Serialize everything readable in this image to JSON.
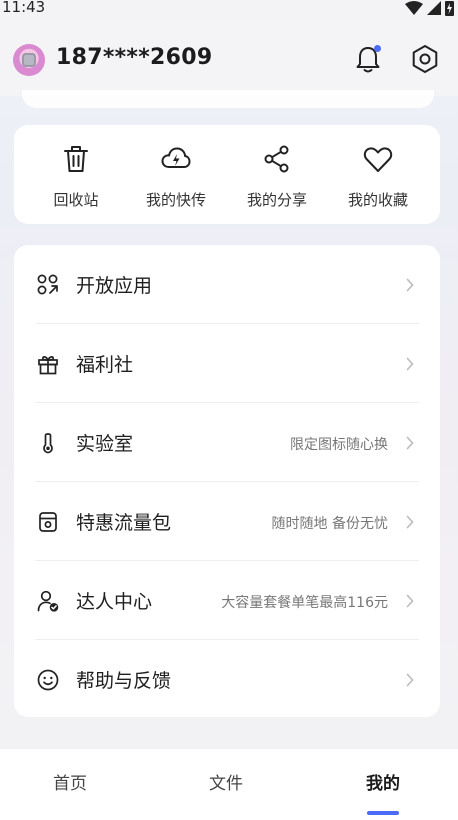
{
  "status": {
    "time": "11:43"
  },
  "header": {
    "username": "187****2609"
  },
  "quick_actions": [
    {
      "label": "回收站",
      "icon": "trash-icon"
    },
    {
      "label": "我的快传",
      "icon": "cloud-upload-icon"
    },
    {
      "label": "我的分享",
      "icon": "share-icon"
    },
    {
      "label": "我的收藏",
      "icon": "heart-icon"
    }
  ],
  "menu": [
    {
      "label": "开放应用",
      "note": "",
      "icon": "apps-icon"
    },
    {
      "label": "福利社",
      "note": "",
      "icon": "gift-icon"
    },
    {
      "label": "实验室",
      "note": "限定图标随心换",
      "icon": "thermometer-icon"
    },
    {
      "label": "特惠流量包",
      "note": "随时随地 备份无忧",
      "icon": "data-package-icon"
    },
    {
      "label": "达人中心",
      "note": "大容量套餐单笔最高116元",
      "icon": "user-verified-icon"
    },
    {
      "label": "帮助与反馈",
      "note": "",
      "icon": "smiley-icon"
    }
  ],
  "tabs": [
    {
      "label": "首页"
    },
    {
      "label": "文件"
    },
    {
      "label": "我的",
      "active": true
    }
  ],
  "colors": {
    "accent": "#4a6cf7",
    "card": "#ffffff"
  }
}
